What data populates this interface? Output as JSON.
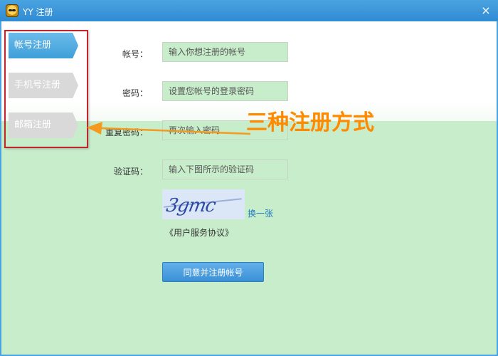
{
  "window": {
    "title": "YY 注册",
    "close_glyph": "×"
  },
  "tabs": [
    {
      "label": "帐号注册",
      "active": true
    },
    {
      "label": "手机号注册",
      "active": false
    },
    {
      "label": "邮箱注册",
      "active": false
    }
  ],
  "form": {
    "account_label": "帐号：",
    "account_placeholder": "输入你想注册的帐号",
    "password_label": "密码：",
    "password_placeholder": "设置您帐号的登录密码",
    "repeat_password_label": "重复密码：",
    "repeat_password_placeholder": "再次输入密码",
    "captcha_label": "验证码：",
    "captcha_placeholder": "输入下图所示的验证码",
    "captcha_code": "3gmc",
    "refresh_link": "换一张",
    "agreement_link": "《用户服务协议》",
    "submit_label": "同意并注册帐号"
  },
  "annotation": {
    "text": "三种注册方式",
    "color": "#ff8a00"
  },
  "colors": {
    "accent_blue": "#3f9fd9",
    "highlight_green": "#c8edcb",
    "annotation_red": "#c0262c"
  }
}
